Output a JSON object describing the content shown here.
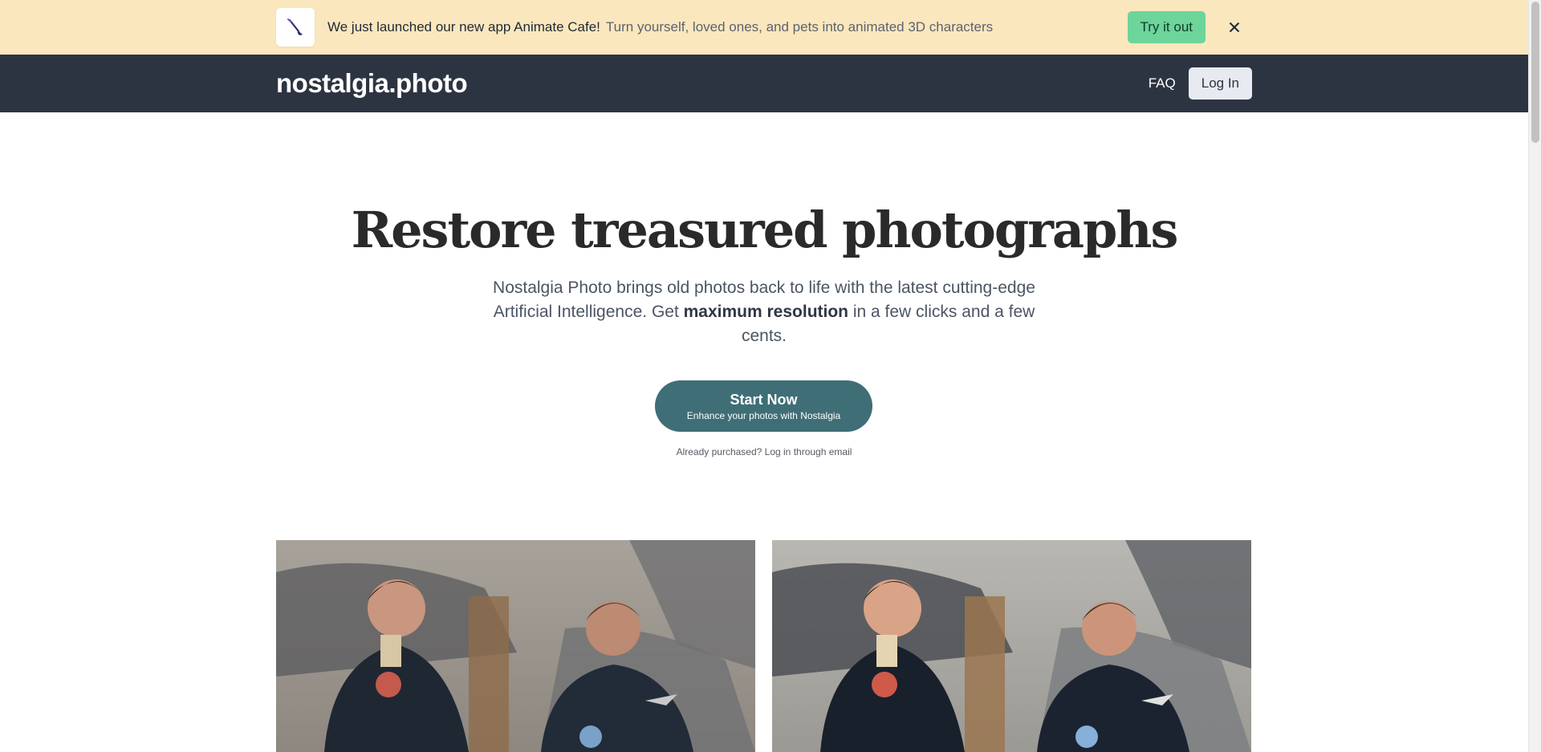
{
  "banner": {
    "icon": "paintbrush-icon",
    "headline": "We just launched our new app Animate Cafe!",
    "subtext": "Turn yourself, loved ones, and pets into animated 3D characters",
    "cta_label": "Try it out",
    "close_icon": "close-icon"
  },
  "nav": {
    "logo": "nostalgia.photo",
    "faq_label": "FAQ",
    "login_label": "Log In"
  },
  "hero": {
    "title": "Restore treasured photographs",
    "description_before": "Nostalgia Photo brings old photos back to life with the latest cutting-edge Artificial Intelligence. Get ",
    "description_bold": "maximum resolution",
    "description_after": " in a few clicks and a few cents.",
    "cta_main": "Start Now",
    "cta_sub": "Enhance your photos with Nostalgia",
    "login_hint": "Already purchased? Log in through email"
  },
  "photos": {
    "before_label": "",
    "after_label": ""
  },
  "colors": {
    "banner_bg": "#fbe7bd",
    "cta_green": "#6dd49a",
    "nav_bg": "#2d3441",
    "start_button": "#3f6e76"
  }
}
